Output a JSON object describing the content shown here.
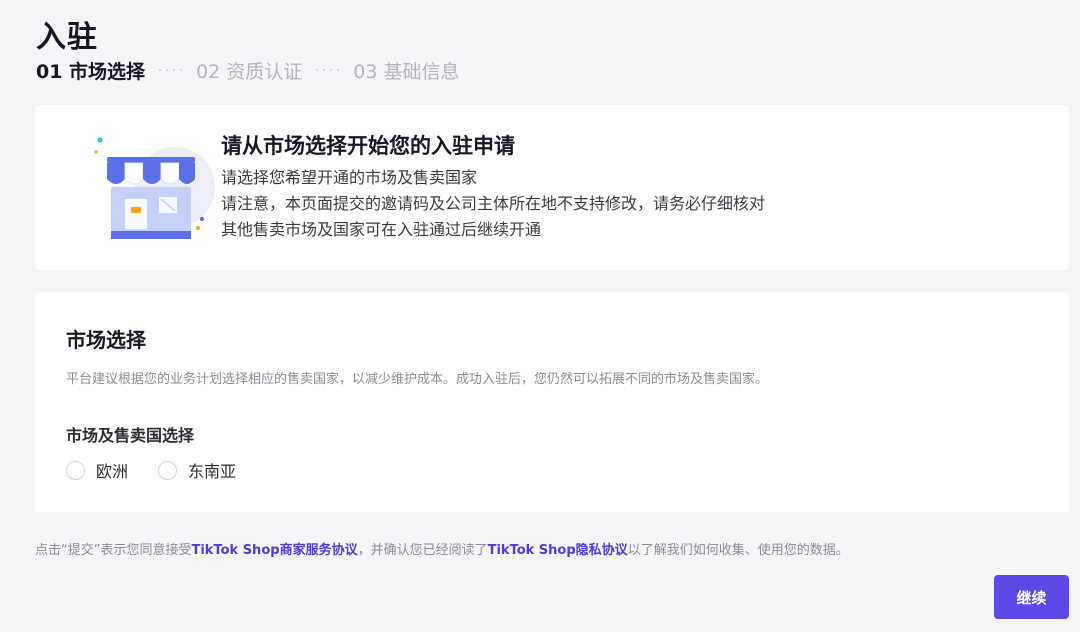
{
  "page": {
    "title": "入驻"
  },
  "steps": [
    {
      "label": "01 市场选择",
      "active": true
    },
    {
      "label": "02 资质认证",
      "active": false
    },
    {
      "label": "03 基础信息",
      "active": false
    }
  ],
  "intro": {
    "heading": "请从市场选择开始您的入驻申请",
    "lines": [
      "请选择您希望开通的市场及售卖国家",
      "请注意，本页面提交的邀请码及公司主体所在地不支持修改，请务必仔细核对",
      "其他售卖市场及国家可在入驻通过后继续开通"
    ]
  },
  "market": {
    "title": "市场选择",
    "description": "平台建议根据您的业务计划选择相应的售卖国家，以减少维护成本。成功入驻后，您仍然可以拓展不同的市场及售卖国家。",
    "region_label": "市场及售卖国选择",
    "options": [
      {
        "label": "欧洲",
        "selected": false
      },
      {
        "label": "东南亚",
        "selected": false
      }
    ]
  },
  "agreement": {
    "prefix": "点击“提交”表示您同意接受",
    "brand1": "TikTok Shop",
    "link1": "商家服务协议",
    "middle": "，并确认您已经阅读了",
    "brand2": "TikTok Shop",
    "link2": "隐私协议",
    "suffix": "以了解我们如何收集、使用您的数据。"
  },
  "actions": {
    "continue_label": "继续"
  },
  "colors": {
    "accent": "#5b4ae8",
    "link": "#4d3cd6",
    "background": "#f5f5f7"
  }
}
